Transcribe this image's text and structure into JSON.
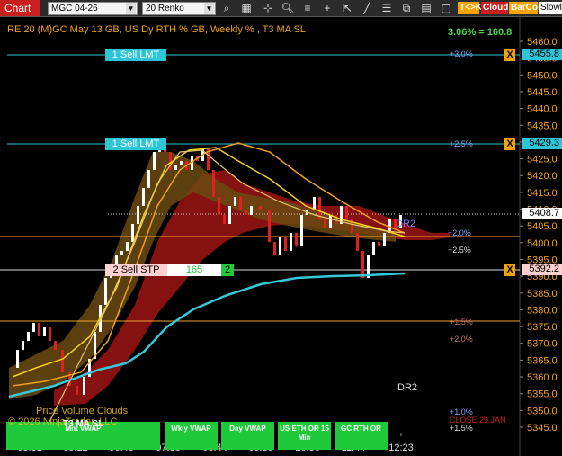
{
  "toolbar": {
    "chart_label": "Chart",
    "instrument": "MGC 04-26",
    "bar_type": "20 Renko",
    "tk_label": "T<>K",
    "cloud_label": "Cloud",
    "barcol_label": "BarCol",
    "slow_label": "Slowl",
    "icons": [
      "search-icon",
      "zoom-icon",
      "crosshair-icon",
      "add-icon",
      "draw-icon",
      "properties-icon",
      "tile-icon",
      "lines-icon",
      "grid-icon",
      "chart-type-icon",
      "cursor-icon",
      "sync-icon",
      "pencil-icon",
      "window-icon"
    ]
  },
  "chart": {
    "title": "RE 20  (M)GC May 13 GB, US Dy RTH % GB, Weekly % , T3 MA SL",
    "summary": "3.06% = 160.8",
    "current_price": "5408.7",
    "price_axis": [
      "5460.0",
      "5455.0",
      "5450.0",
      "5445.0",
      "5440.0",
      "5435.0",
      "5430.0",
      "5425.0",
      "5420.0",
      "5415.0",
      "5410.0",
      "5405.0",
      "5400.0",
      "5395.0",
      "5390.0",
      "5385.0",
      "5380.0",
      "5375.0",
      "5370.0",
      "5365.0",
      "5360.0",
      "5355.0",
      "5350.0",
      "5345.0"
    ],
    "time_axis": [
      "03:31",
      "05:12",
      "06:43",
      "07:38",
      "08:44",
      "09:36",
      "10:36",
      "11:44",
      "12:23"
    ],
    "orders": {
      "sell_lmt_1": {
        "label": "1 Sell LMT",
        "price": "5455.8"
      },
      "sell_lmt_2": {
        "label": "1 Sell LMT",
        "price": "5429.3"
      },
      "sell_stp": {
        "label": "2 Sell STP",
        "value": "165",
        "count": "2",
        "price": "5392.2"
      },
      "cancel_glyph": "X"
    },
    "percent_labels": {
      "p30": "+3.0%",
      "p25": "+2.5%",
      "p20a": "+2.0%",
      "p25b": "+2.5%",
      "p15": "+1.5%",
      "p20b": "+2.0%",
      "p10": "+1.0%",
      "p15b": "+1.5%"
    },
    "dr2_a": "DR2",
    "dr2_b": "DR2",
    "close_label": "CLOSE 29 JAN",
    "watermark_line1": "Price Volume Clouds",
    "watermark_line2": "© 2026 NinjaTrader, LLC",
    "indicator_buttons": {
      "mnt_vwap": "Mnt VWAP",
      "t3_ma_sl": "T3 MA SL",
      "wkly_vwap": "Wkly VWAP",
      "day_vwap": "Day VWAP",
      "us_eth": "US ETH OR 15 Min",
      "gc_rth": "GC RTH OR"
    },
    "colors": {
      "chart_red": "#c8201f",
      "order_line": "#2ec6d6",
      "stop_line": "#f0a030",
      "vwap_cyan": "#36c8d8",
      "ma_yellow": "#f0d020",
      "ma_orange": "#f0a020",
      "summary_green": "#4fd34f",
      "button_green": "#1ec93a",
      "cloud_red": "#9c1414"
    }
  }
}
